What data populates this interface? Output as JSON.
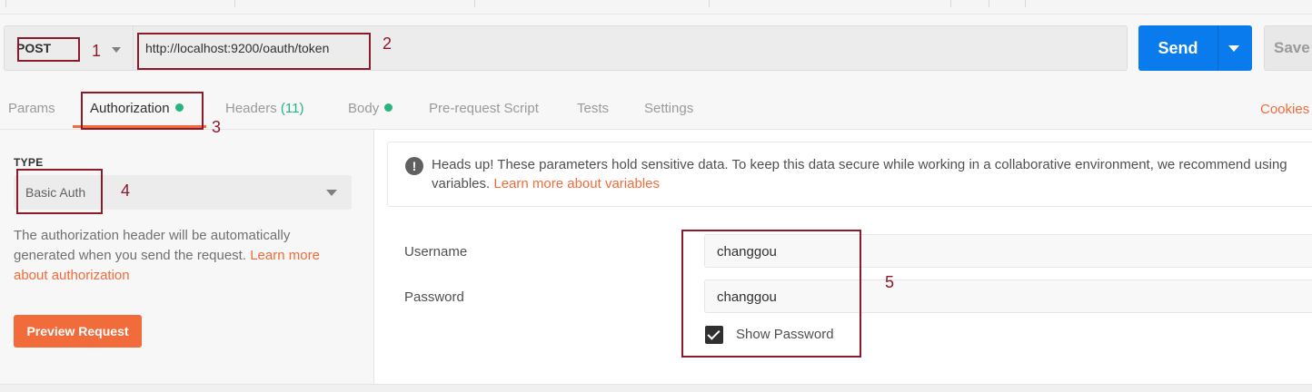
{
  "request": {
    "method": "POST",
    "url": "http://localhost:9200/oauth/token",
    "send_label": "Send",
    "save_label": "Save"
  },
  "tabs": [
    {
      "label": "Params"
    },
    {
      "label": "Authorization",
      "active": true,
      "indicator": "dot"
    },
    {
      "label": "Headers",
      "count": "(11)"
    },
    {
      "label": "Body",
      "indicator": "dot"
    },
    {
      "label": "Pre-request Script"
    },
    {
      "label": "Tests"
    },
    {
      "label": "Settings"
    }
  ],
  "cookies_label": "Cookies",
  "auth": {
    "type_label": "TYPE",
    "type_value": "Basic Auth",
    "description": "The authorization header will be automatically generated when you send the request.",
    "learn_more": "Learn more about authorization",
    "preview_button": "Preview Request"
  },
  "notice": {
    "text": "Heads up! These parameters hold sensitive data. To keep this data secure while working in a collaborative environment, we recommend using variables.",
    "link": "Learn more about variables"
  },
  "fields": {
    "username_label": "Username",
    "username_value": "changgou",
    "password_label": "Password",
    "password_value": "changgou",
    "show_password_label": "Show Password",
    "show_password_checked": true
  },
  "annotations": [
    "1",
    "2",
    "3",
    "4",
    "5"
  ],
  "colors": {
    "accent": "#f26b3a",
    "send": "#097bed",
    "indicator": "#26b47f",
    "annotation": "#8b1a2b"
  }
}
